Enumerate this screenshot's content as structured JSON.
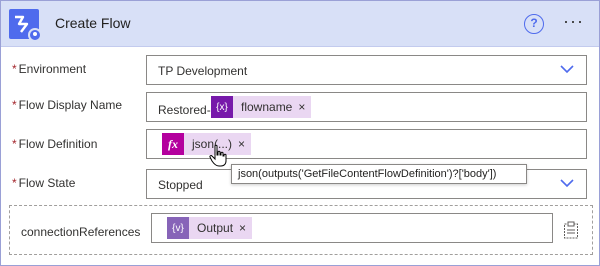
{
  "header": {
    "title": "Create Flow",
    "help_glyph": "?",
    "more_glyph": "···",
    "icon": "power-automate-icon",
    "accent": "#4f6bed",
    "background": "#d8e0f7"
  },
  "fields": {
    "environment": {
      "label": "Environment",
      "required_mark": "*",
      "value": "TP Development"
    },
    "display_name": {
      "label": "Flow Display Name",
      "required_mark": "*",
      "prefix_text": "Restored-",
      "token_label": "flowname",
      "token_icon_text": "{x}",
      "token_color": "#7719aa"
    },
    "definition": {
      "label": "Flow Definition",
      "required_mark": "*",
      "token_label": "json(...)",
      "token_icon_text": "fx",
      "token_color": "#b4009e"
    },
    "state": {
      "label": "Flow State",
      "required_mark": "*",
      "value": "Stopped"
    },
    "connection_references": {
      "label": "connectionReferences",
      "token_label": "Output",
      "token_icon_text": "{v}",
      "token_color": "#8764b8"
    }
  },
  "tooltip": {
    "text": "json(outputs('GetFileContentFlowDefinition')?['body'])"
  },
  "token_close_glyph": "×"
}
